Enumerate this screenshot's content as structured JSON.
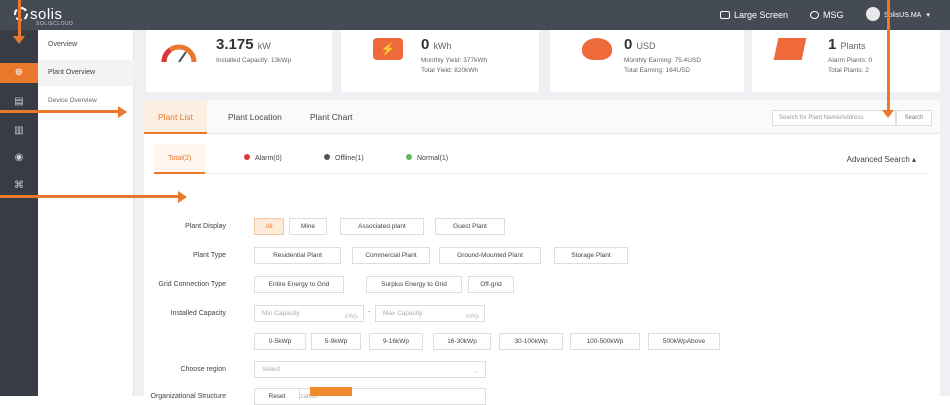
{
  "topbar": {
    "logo": "solis",
    "logo_sub": "SOLISCLOUD",
    "large_screen": "Large Screen",
    "msg": "MSG",
    "user": "SolisUS.MA",
    "bg_color": "#454b55"
  },
  "sidebar": {
    "icons": [
      "globe-icon",
      "database-icon",
      "chart-icon",
      "eye-icon",
      "grid-icon"
    ],
    "active_color": "#e8782b"
  },
  "menu": {
    "items": [
      {
        "label": "Overview"
      },
      {
        "label": "Plant Overview"
      },
      {
        "label": "Device Overview"
      }
    ]
  },
  "cards": {
    "capacity": {
      "value": "3.175",
      "unit": "kW",
      "installed": "Installed Capacity: 13kWp"
    },
    "energy": {
      "value": "0",
      "unit": "kWh",
      "monthly": "Monthly Yield: 377kWh",
      "total": "Total Yield: 820kWh"
    },
    "earning": {
      "value": "0",
      "unit": "USD",
      "monthly": "Monthly Earning: 75.4USD",
      "total": "Total Earning: 164USD"
    },
    "plants": {
      "value": "1",
      "unit": "Plants",
      "alarm": "Alarm Plants: 0",
      "total": "Total Plants: 2"
    }
  },
  "tabs": [
    "Plant List",
    "Plant Location",
    "Plant Chart"
  ],
  "search": {
    "placeholder": "Search for Plant Name/Address",
    "button": "Search"
  },
  "status": {
    "total": "Total(2)",
    "alarm": "Alarm(0)",
    "offline": "Offline(1)",
    "normal": "Normal(1)",
    "colors": {
      "alarm": "#d9393e",
      "offline": "#555555",
      "normal": "#5cb85c"
    }
  },
  "advanced": "Advanced Search ▴",
  "filters": {
    "plant_display": {
      "label": "Plant Display",
      "options": [
        "All",
        "Mine",
        "Associated plant",
        "Guest Plant"
      ],
      "selected": "All"
    },
    "plant_type": {
      "label": "Plant Type",
      "options": [
        "Residential Plant",
        "Commercial Plant",
        "Ground-Mounted Plant",
        "Storage Plant"
      ]
    },
    "grid_type": {
      "label": "Grid Connection Type",
      "options": [
        "Entire Energy to Grid",
        "Surplus Energy to Grid",
        "Off-grid"
      ]
    },
    "capacity": {
      "label": "Installed Capacity",
      "min_placeholder": "Min Capacity",
      "max_placeholder": "Max Capacity",
      "unit": "kWp",
      "dash": "-",
      "ranges": [
        "0-5kWp",
        "5-9kWp",
        "9-16kWp",
        "16-30kWp",
        "30-100kWp",
        "100-500kWp",
        "500kWpAbove"
      ]
    },
    "region": {
      "label": "Choose region",
      "placeholder": "Select"
    },
    "org": {
      "label": "Organizational Structure",
      "placeholder": "Select organization"
    }
  },
  "footer_buttons": {
    "reset": "Reset"
  }
}
